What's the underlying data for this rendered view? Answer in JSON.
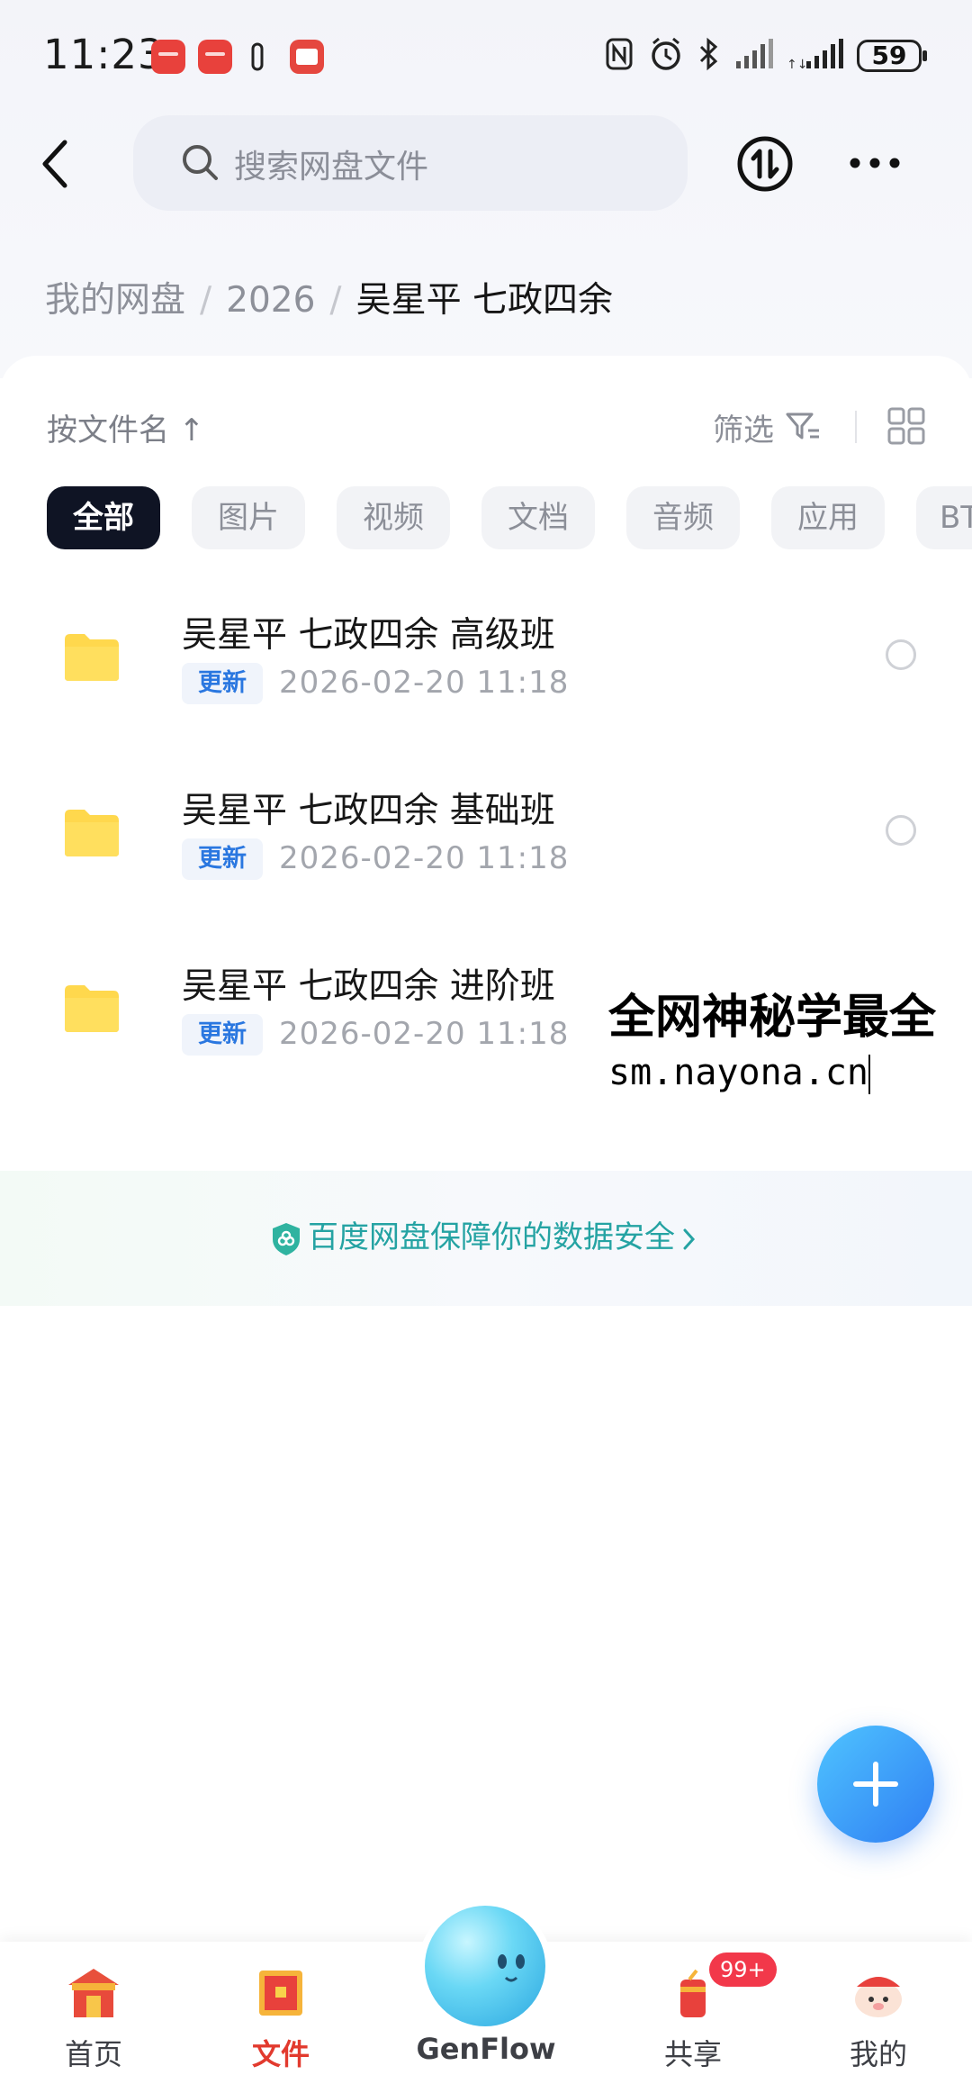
{
  "status_bar": {
    "time": "11:23",
    "battery": "59"
  },
  "header": {
    "search_placeholder": "搜索网盘文件"
  },
  "breadcrumb": {
    "root": "我的网盘",
    "sep": "/",
    "level1": "2026",
    "current": "吴星平 七政四余"
  },
  "toolbar": {
    "sort_label": "按文件名 ↑",
    "filter_label": "筛选"
  },
  "categories": [
    "全部",
    "图片",
    "视频",
    "文档",
    "音频",
    "应用",
    "BT"
  ],
  "files": [
    {
      "name": "吴星平 七政四余 高级班",
      "tag": "更新",
      "date": "2026-02-20  11:18"
    },
    {
      "name": "吴星平 七政四余 基础班",
      "tag": "更新",
      "date": "2026-02-20  11:18"
    },
    {
      "name": "吴星平 七政四余 进阶班",
      "tag": "更新",
      "date": "2026-02-20  11:18"
    }
  ],
  "watermark": {
    "line1": "全网神秘学最全",
    "line2": "sm.nayona.cn"
  },
  "security": {
    "text": "百度网盘保障你的数据安全"
  },
  "nav": {
    "home": "首页",
    "files": "文件",
    "genflow": "GenFlow",
    "share": "共享",
    "share_badge": "99+",
    "mine": "我的"
  },
  "colors": {
    "accent": "#2f7ef3",
    "active_nav": "#e23a2e",
    "folder": "#ffd84d",
    "secure": "#25a3a3"
  }
}
